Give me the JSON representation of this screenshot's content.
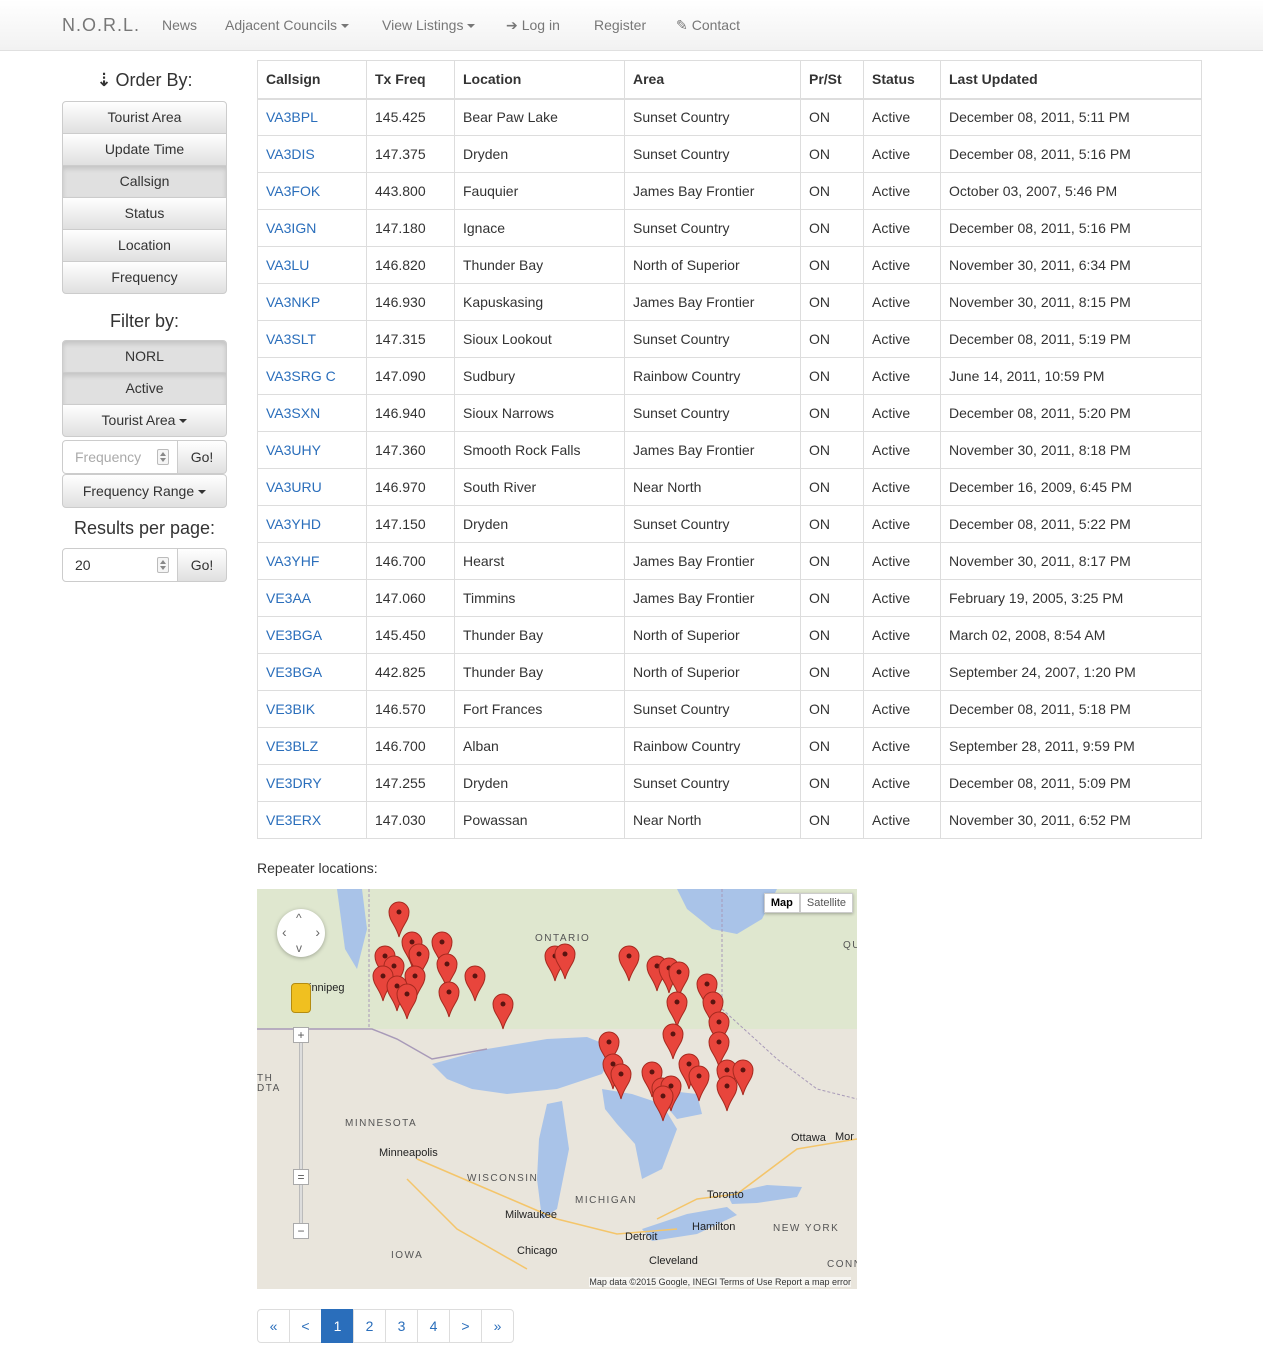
{
  "navbar": {
    "brand": "N.O.R.L.",
    "items": [
      {
        "label": "News"
      },
      {
        "label": "Adjacent Councils"
      },
      {
        "label": "View Listings"
      },
      {
        "label": "Log in"
      },
      {
        "label": "Register"
      },
      {
        "label": "Contact"
      }
    ]
  },
  "sidebar": {
    "order_heading": "Order By:",
    "order_buttons": [
      "Tourist Area",
      "Update Time",
      "Callsign",
      "Status",
      "Location",
      "Frequency"
    ],
    "order_active": "Callsign",
    "filter_heading": "Filter by:",
    "filter_buttons": [
      "NORL",
      "Active",
      "Tourist Area"
    ],
    "frequency_placeholder": "Frequency",
    "go_label": "Go!",
    "frequency_range_label": "Frequency Range",
    "results_heading": "Results per page:",
    "results_value": "20"
  },
  "table": {
    "headers": [
      "Callsign",
      "Tx Freq",
      "Location",
      "Area",
      "Pr/St",
      "Status",
      "Last Updated"
    ],
    "rows": [
      [
        "VA3BPL",
        "145.425",
        "Bear Paw Lake",
        "Sunset Country",
        "ON",
        "Active",
        "December 08, 2011, 5:11 PM"
      ],
      [
        "VA3DIS",
        "147.375",
        "Dryden",
        "Sunset Country",
        "ON",
        "Active",
        "December 08, 2011, 5:16 PM"
      ],
      [
        "VA3FOK",
        "443.800",
        "Fauquier",
        "James Bay Frontier",
        "ON",
        "Active",
        "October 03, 2007, 5:46 PM"
      ],
      [
        "VA3IGN",
        "147.180",
        "Ignace",
        "Sunset Country",
        "ON",
        "Active",
        "December 08, 2011, 5:16 PM"
      ],
      [
        "VA3LU",
        "146.820",
        "Thunder Bay",
        "North of Superior",
        "ON",
        "Active",
        "November 30, 2011, 6:34 PM"
      ],
      [
        "VA3NKP",
        "146.930",
        "Kapuskasing",
        "James Bay Frontier",
        "ON",
        "Active",
        "November 30, 2011, 8:15 PM"
      ],
      [
        "VA3SLT",
        "147.315",
        "Sioux Lookout",
        "Sunset Country",
        "ON",
        "Active",
        "December 08, 2011, 5:19 PM"
      ],
      [
        "VA3SRG C",
        "147.090",
        "Sudbury",
        "Rainbow Country",
        "ON",
        "Active",
        "June 14, 2011, 10:59 PM"
      ],
      [
        "VA3SXN",
        "146.940",
        "Sioux Narrows",
        "Sunset Country",
        "ON",
        "Active",
        "December 08, 2011, 5:20 PM"
      ],
      [
        "VA3UHY",
        "147.360",
        "Smooth Rock Falls",
        "James Bay Frontier",
        "ON",
        "Active",
        "November 30, 2011, 8:18 PM"
      ],
      [
        "VA3URU",
        "146.970",
        "South River",
        "Near North",
        "ON",
        "Active",
        "December 16, 2009, 6:45 PM"
      ],
      [
        "VA3YHD",
        "147.150",
        "Dryden",
        "Sunset Country",
        "ON",
        "Active",
        "December 08, 2011, 5:22 PM"
      ],
      [
        "VA3YHF",
        "146.700",
        "Hearst",
        "James Bay Frontier",
        "ON",
        "Active",
        "November 30, 2011, 8:17 PM"
      ],
      [
        "VE3AA",
        "147.060",
        "Timmins",
        "James Bay Frontier",
        "ON",
        "Active",
        "February 19, 2005, 3:25 PM"
      ],
      [
        "VE3BGA",
        "145.450",
        "Thunder Bay",
        "North of Superior",
        "ON",
        "Active",
        "March 02, 2008, 8:54 AM"
      ],
      [
        "VE3BGA",
        "442.825",
        "Thunder Bay",
        "North of Superior",
        "ON",
        "Active",
        "September 24, 2007, 1:20 PM"
      ],
      [
        "VE3BIK",
        "146.570",
        "Fort Frances",
        "Sunset Country",
        "ON",
        "Active",
        "December 08, 2011, 5:18 PM"
      ],
      [
        "VE3BLZ",
        "146.700",
        "Alban",
        "Rainbow Country",
        "ON",
        "Active",
        "September 28, 2011, 9:59 PM"
      ],
      [
        "VE3DRY",
        "147.255",
        "Dryden",
        "Sunset Country",
        "ON",
        "Active",
        "December 08, 2011, 5:09 PM"
      ],
      [
        "VE3ERX",
        "147.030",
        "Powassan",
        "Near North",
        "ON",
        "Active",
        "November 30, 2011, 6:52 PM"
      ]
    ]
  },
  "map": {
    "label": "Repeater locations:",
    "type_map": "Map",
    "type_satellite": "Satellite",
    "footer": "Map data ©2015 Google, INEGI   Terms of Use   Report a map error",
    "places": [
      "ONTARIO",
      "innipeg",
      "MINNESOTA",
      "Minneapolis",
      "WISCONSIN",
      "MICHIGAN",
      "Milwaukee",
      "Chicago",
      "Detroit",
      "Toronto",
      "Hamilton",
      "NEW YORK",
      "Cleveland",
      "Ottawa",
      "IOWA",
      "Mor",
      "QU",
      "TH",
      "DTA",
      "CONN"
    ],
    "marker_color": "#e8453c"
  },
  "pagination": {
    "items": [
      "«",
      "<",
      "1",
      "2",
      "3",
      "4",
      ">",
      "»"
    ],
    "current": "1"
  }
}
